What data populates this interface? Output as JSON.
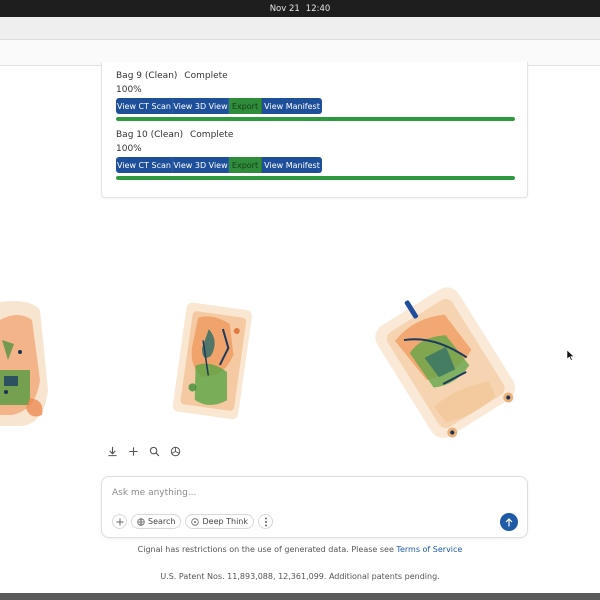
{
  "system_bar": {
    "date": "Nov 21",
    "time": "12:40"
  },
  "bags": [
    {
      "name": "Bag 9 (Clean)",
      "status": "Complete",
      "progress_text": "100%",
      "progress": 1.0,
      "buttons": {
        "ct": "View CT Scan",
        "view3d": "View 3D View",
        "export": "Export",
        "manifest": "View Manifest"
      }
    },
    {
      "name": "Bag 10 (Clean)",
      "status": "Complete",
      "progress_text": "100%",
      "progress": 1.0,
      "buttons": {
        "ct": "View CT Scan",
        "view3d": "View 3D View",
        "export": "Export",
        "manifest": "View Manifest"
      }
    }
  ],
  "image_toolbar": {
    "icons": [
      "download-icon",
      "plus-icon",
      "zoom-icon",
      "3d-view-icon"
    ]
  },
  "chat": {
    "placeholder": "Ask me anything...",
    "search_label": "Search",
    "deep_think_label": "Deep Think"
  },
  "footer": {
    "disclaimer": "Cignal has restrictions on the use of generated data. Please see",
    "terms_link": "Terms of Service",
    "patents": "U.S. Patent Nos. 11,893,088, 12,361,099. Additional patents pending."
  },
  "colors": {
    "button_blue": "#1e4f9a",
    "export_green": "#2f8c3a",
    "progress_green": "#2e9a3f",
    "send_blue": "#1f5aa6"
  }
}
